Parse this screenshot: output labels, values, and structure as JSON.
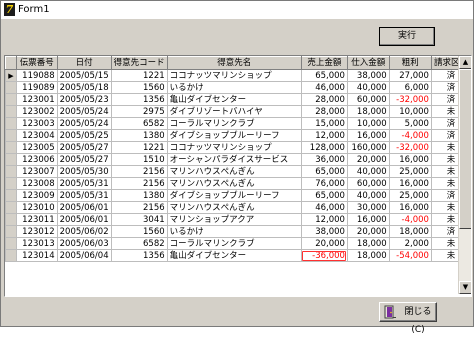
{
  "window": {
    "title": "Form1",
    "icon": "vb-app-icon"
  },
  "toolbar": {
    "run_label": "実行"
  },
  "footer": {
    "close_label": "閉じる(C)"
  },
  "grid": {
    "columns": [
      "伝票番号",
      "日付",
      "得意先コード",
      "得意先名",
      "売上金額",
      "仕入金額",
      "粗利",
      "請求区分"
    ],
    "current_row_marker": "▶",
    "rows": [
      [
        "119088",
        "2005/05/15",
        "1221",
        "ココナッツマリンショップ",
        "65,000",
        "38,000",
        "27,000",
        "済"
      ],
      [
        "119089",
        "2005/05/18",
        "1560",
        "いるかけ",
        "46,000",
        "40,000",
        "6,000",
        "済"
      ],
      [
        "123001",
        "2005/05/23",
        "1356",
        "亀山ダイブセンター",
        "28,000",
        "60,000",
        "-32,000",
        "済"
      ],
      [
        "123002",
        "2005/05/24",
        "2975",
        "ダイブリゾートバハイヤ",
        "28,000",
        "18,000",
        "10,000",
        "未"
      ],
      [
        "123003",
        "2005/05/24",
        "6582",
        "コーラルマリンクラブ",
        "15,000",
        "10,000",
        "5,000",
        "済"
      ],
      [
        "123004",
        "2005/05/25",
        "1380",
        "ダイブショップブルーリーフ",
        "12,000",
        "16,000",
        "-4,000",
        "済"
      ],
      [
        "123005",
        "2005/05/27",
        "1221",
        "ココナッツマリンショップ",
        "128,000",
        "160,000",
        "-32,000",
        "未"
      ],
      [
        "123006",
        "2005/05/27",
        "1510",
        "オーシャンパラダイスサービス",
        "36,000",
        "20,000",
        "16,000",
        "未"
      ],
      [
        "123007",
        "2005/05/30",
        "2156",
        "マリンハウスぺんぎん",
        "65,000",
        "40,000",
        "25,000",
        "未"
      ],
      [
        "123008",
        "2005/05/31",
        "2156",
        "マリンハウスぺんぎん",
        "76,000",
        "60,000",
        "16,000",
        "未"
      ],
      [
        "123009",
        "2005/05/31",
        "1380",
        "ダイブショップブルーリーフ",
        "65,000",
        "40,000",
        "25,000",
        "済"
      ],
      [
        "123010",
        "2005/06/01",
        "2156",
        "マリンハウスぺんぎん",
        "46,000",
        "30,000",
        "16,000",
        "未"
      ],
      [
        "123011",
        "2005/06/01",
        "3041",
        "マリンショップアクア",
        "12,000",
        "16,000",
        "-4,000",
        "未"
      ],
      [
        "123012",
        "2005/06/02",
        "1560",
        "いるかけ",
        "38,000",
        "20,000",
        "18,000",
        "済"
      ],
      [
        "123013",
        "2005/06/03",
        "6582",
        "コーラルマリンクラブ",
        "20,000",
        "18,000",
        "2,000",
        "未"
      ],
      [
        "123014",
        "2005/06/04",
        "1356",
        "亀山ダイブセンター",
        "-36,000",
        "18,000",
        "-54,000",
        "未"
      ]
    ],
    "editing_cell": {
      "row": 15,
      "col": 4
    }
  },
  "colors": {
    "negative_value": "#ff0000",
    "edit_outline": "#ff3030",
    "face": "#d4d0c8"
  },
  "scrollbar": {
    "up_icon": "scroll-up-arrow-icon",
    "down_icon": "scroll-down-arrow-icon",
    "position_fraction": 0.0
  }
}
